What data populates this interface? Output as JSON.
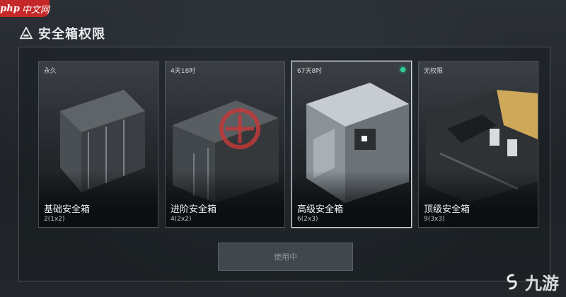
{
  "watermark_top": {
    "brand": "php",
    "site": "中文网"
  },
  "header": {
    "title": "安全箱权限"
  },
  "cards": [
    {
      "duration": "永久",
      "name": "基础安全箱",
      "size": "2(1x2)",
      "selected": false,
      "indicator": false
    },
    {
      "duration": "4天18时",
      "name": "进阶安全箱",
      "size": "4(2x2)",
      "selected": false,
      "indicator": false
    },
    {
      "duration": "67天8时",
      "name": "高级安全箱",
      "size": "6(2x3)",
      "selected": true,
      "indicator": true
    },
    {
      "duration": "无权限",
      "name": "顶级安全箱",
      "size": "9(3x3)",
      "selected": false,
      "indicator": false
    }
  ],
  "action": {
    "label": "使用中"
  },
  "watermark_br": {
    "text": "九游"
  },
  "colors": {
    "indicator": "#2fd49a",
    "accent_red": "#d22828",
    "selected_border": "#cfd6dc"
  }
}
